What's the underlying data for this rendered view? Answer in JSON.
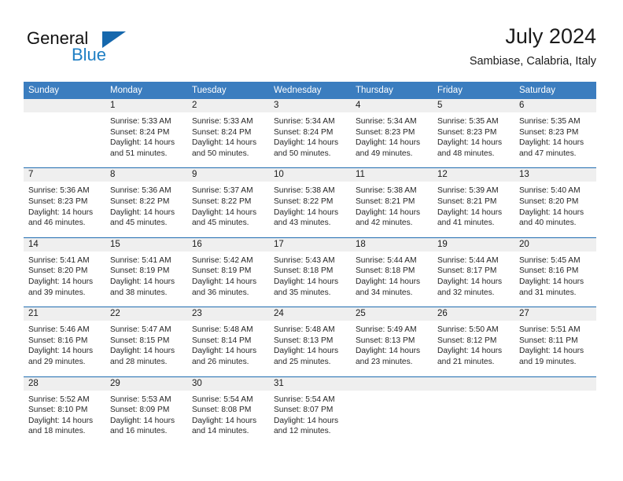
{
  "brand": {
    "name_part1": "General",
    "name_part2": "Blue",
    "flag_icon": "triangle-flag-icon",
    "accent_color": "#1668ad"
  },
  "header": {
    "title": "July 2024",
    "subtitle": "Sambiase, Calabria, Italy"
  },
  "theme": {
    "header_bg": "#3b7dbf",
    "header_text": "#ffffff",
    "row_rule": "#1f6cb0",
    "day_number_bg": "#efefef",
    "body_text": "#262626"
  },
  "weekdays": [
    "Sunday",
    "Monday",
    "Tuesday",
    "Wednesday",
    "Thursday",
    "Friday",
    "Saturday"
  ],
  "weeks": [
    [
      {
        "day": "",
        "empty": true,
        "sunrise": "",
        "sunset": "",
        "daylight_line1": "",
        "daylight_line2": ""
      },
      {
        "day": "1",
        "sunrise": "Sunrise: 5:33 AM",
        "sunset": "Sunset: 8:24 PM",
        "daylight_line1": "Daylight: 14 hours",
        "daylight_line2": "and 51 minutes."
      },
      {
        "day": "2",
        "sunrise": "Sunrise: 5:33 AM",
        "sunset": "Sunset: 8:24 PM",
        "daylight_line1": "Daylight: 14 hours",
        "daylight_line2": "and 50 minutes."
      },
      {
        "day": "3",
        "sunrise": "Sunrise: 5:34 AM",
        "sunset": "Sunset: 8:24 PM",
        "daylight_line1": "Daylight: 14 hours",
        "daylight_line2": "and 50 minutes."
      },
      {
        "day": "4",
        "sunrise": "Sunrise: 5:34 AM",
        "sunset": "Sunset: 8:23 PM",
        "daylight_line1": "Daylight: 14 hours",
        "daylight_line2": "and 49 minutes."
      },
      {
        "day": "5",
        "sunrise": "Sunrise: 5:35 AM",
        "sunset": "Sunset: 8:23 PM",
        "daylight_line1": "Daylight: 14 hours",
        "daylight_line2": "and 48 minutes."
      },
      {
        "day": "6",
        "sunrise": "Sunrise: 5:35 AM",
        "sunset": "Sunset: 8:23 PM",
        "daylight_line1": "Daylight: 14 hours",
        "daylight_line2": "and 47 minutes."
      }
    ],
    [
      {
        "day": "7",
        "sunrise": "Sunrise: 5:36 AM",
        "sunset": "Sunset: 8:23 PM",
        "daylight_line1": "Daylight: 14 hours",
        "daylight_line2": "and 46 minutes."
      },
      {
        "day": "8",
        "sunrise": "Sunrise: 5:36 AM",
        "sunset": "Sunset: 8:22 PM",
        "daylight_line1": "Daylight: 14 hours",
        "daylight_line2": "and 45 minutes."
      },
      {
        "day": "9",
        "sunrise": "Sunrise: 5:37 AM",
        "sunset": "Sunset: 8:22 PM",
        "daylight_line1": "Daylight: 14 hours",
        "daylight_line2": "and 45 minutes."
      },
      {
        "day": "10",
        "sunrise": "Sunrise: 5:38 AM",
        "sunset": "Sunset: 8:22 PM",
        "daylight_line1": "Daylight: 14 hours",
        "daylight_line2": "and 43 minutes."
      },
      {
        "day": "11",
        "sunrise": "Sunrise: 5:38 AM",
        "sunset": "Sunset: 8:21 PM",
        "daylight_line1": "Daylight: 14 hours",
        "daylight_line2": "and 42 minutes."
      },
      {
        "day": "12",
        "sunrise": "Sunrise: 5:39 AM",
        "sunset": "Sunset: 8:21 PM",
        "daylight_line1": "Daylight: 14 hours",
        "daylight_line2": "and 41 minutes."
      },
      {
        "day": "13",
        "sunrise": "Sunrise: 5:40 AM",
        "sunset": "Sunset: 8:20 PM",
        "daylight_line1": "Daylight: 14 hours",
        "daylight_line2": "and 40 minutes."
      }
    ],
    [
      {
        "day": "14",
        "sunrise": "Sunrise: 5:41 AM",
        "sunset": "Sunset: 8:20 PM",
        "daylight_line1": "Daylight: 14 hours",
        "daylight_line2": "and 39 minutes."
      },
      {
        "day": "15",
        "sunrise": "Sunrise: 5:41 AM",
        "sunset": "Sunset: 8:19 PM",
        "daylight_line1": "Daylight: 14 hours",
        "daylight_line2": "and 38 minutes."
      },
      {
        "day": "16",
        "sunrise": "Sunrise: 5:42 AM",
        "sunset": "Sunset: 8:19 PM",
        "daylight_line1": "Daylight: 14 hours",
        "daylight_line2": "and 36 minutes."
      },
      {
        "day": "17",
        "sunrise": "Sunrise: 5:43 AM",
        "sunset": "Sunset: 8:18 PM",
        "daylight_line1": "Daylight: 14 hours",
        "daylight_line2": "and 35 minutes."
      },
      {
        "day": "18",
        "sunrise": "Sunrise: 5:44 AM",
        "sunset": "Sunset: 8:18 PM",
        "daylight_line1": "Daylight: 14 hours",
        "daylight_line2": "and 34 minutes."
      },
      {
        "day": "19",
        "sunrise": "Sunrise: 5:44 AM",
        "sunset": "Sunset: 8:17 PM",
        "daylight_line1": "Daylight: 14 hours",
        "daylight_line2": "and 32 minutes."
      },
      {
        "day": "20",
        "sunrise": "Sunrise: 5:45 AM",
        "sunset": "Sunset: 8:16 PM",
        "daylight_line1": "Daylight: 14 hours",
        "daylight_line2": "and 31 minutes."
      }
    ],
    [
      {
        "day": "21",
        "sunrise": "Sunrise: 5:46 AM",
        "sunset": "Sunset: 8:16 PM",
        "daylight_line1": "Daylight: 14 hours",
        "daylight_line2": "and 29 minutes."
      },
      {
        "day": "22",
        "sunrise": "Sunrise: 5:47 AM",
        "sunset": "Sunset: 8:15 PM",
        "daylight_line1": "Daylight: 14 hours",
        "daylight_line2": "and 28 minutes."
      },
      {
        "day": "23",
        "sunrise": "Sunrise: 5:48 AM",
        "sunset": "Sunset: 8:14 PM",
        "daylight_line1": "Daylight: 14 hours",
        "daylight_line2": "and 26 minutes."
      },
      {
        "day": "24",
        "sunrise": "Sunrise: 5:48 AM",
        "sunset": "Sunset: 8:13 PM",
        "daylight_line1": "Daylight: 14 hours",
        "daylight_line2": "and 25 minutes."
      },
      {
        "day": "25",
        "sunrise": "Sunrise: 5:49 AM",
        "sunset": "Sunset: 8:13 PM",
        "daylight_line1": "Daylight: 14 hours",
        "daylight_line2": "and 23 minutes."
      },
      {
        "day": "26",
        "sunrise": "Sunrise: 5:50 AM",
        "sunset": "Sunset: 8:12 PM",
        "daylight_line1": "Daylight: 14 hours",
        "daylight_line2": "and 21 minutes."
      },
      {
        "day": "27",
        "sunrise": "Sunrise: 5:51 AM",
        "sunset": "Sunset: 8:11 PM",
        "daylight_line1": "Daylight: 14 hours",
        "daylight_line2": "and 19 minutes."
      }
    ],
    [
      {
        "day": "28",
        "sunrise": "Sunrise: 5:52 AM",
        "sunset": "Sunset: 8:10 PM",
        "daylight_line1": "Daylight: 14 hours",
        "daylight_line2": "and 18 minutes."
      },
      {
        "day": "29",
        "sunrise": "Sunrise: 5:53 AM",
        "sunset": "Sunset: 8:09 PM",
        "daylight_line1": "Daylight: 14 hours",
        "daylight_line2": "and 16 minutes."
      },
      {
        "day": "30",
        "sunrise": "Sunrise: 5:54 AM",
        "sunset": "Sunset: 8:08 PM",
        "daylight_line1": "Daylight: 14 hours",
        "daylight_line2": "and 14 minutes."
      },
      {
        "day": "31",
        "sunrise": "Sunrise: 5:54 AM",
        "sunset": "Sunset: 8:07 PM",
        "daylight_line1": "Daylight: 14 hours",
        "daylight_line2": "and 12 minutes."
      },
      {
        "day": "",
        "empty": true,
        "sunrise": "",
        "sunset": "",
        "daylight_line1": "",
        "daylight_line2": ""
      },
      {
        "day": "",
        "empty": true,
        "sunrise": "",
        "sunset": "",
        "daylight_line1": "",
        "daylight_line2": ""
      },
      {
        "day": "",
        "empty": true,
        "sunrise": "",
        "sunset": "",
        "daylight_line1": "",
        "daylight_line2": ""
      }
    ]
  ]
}
